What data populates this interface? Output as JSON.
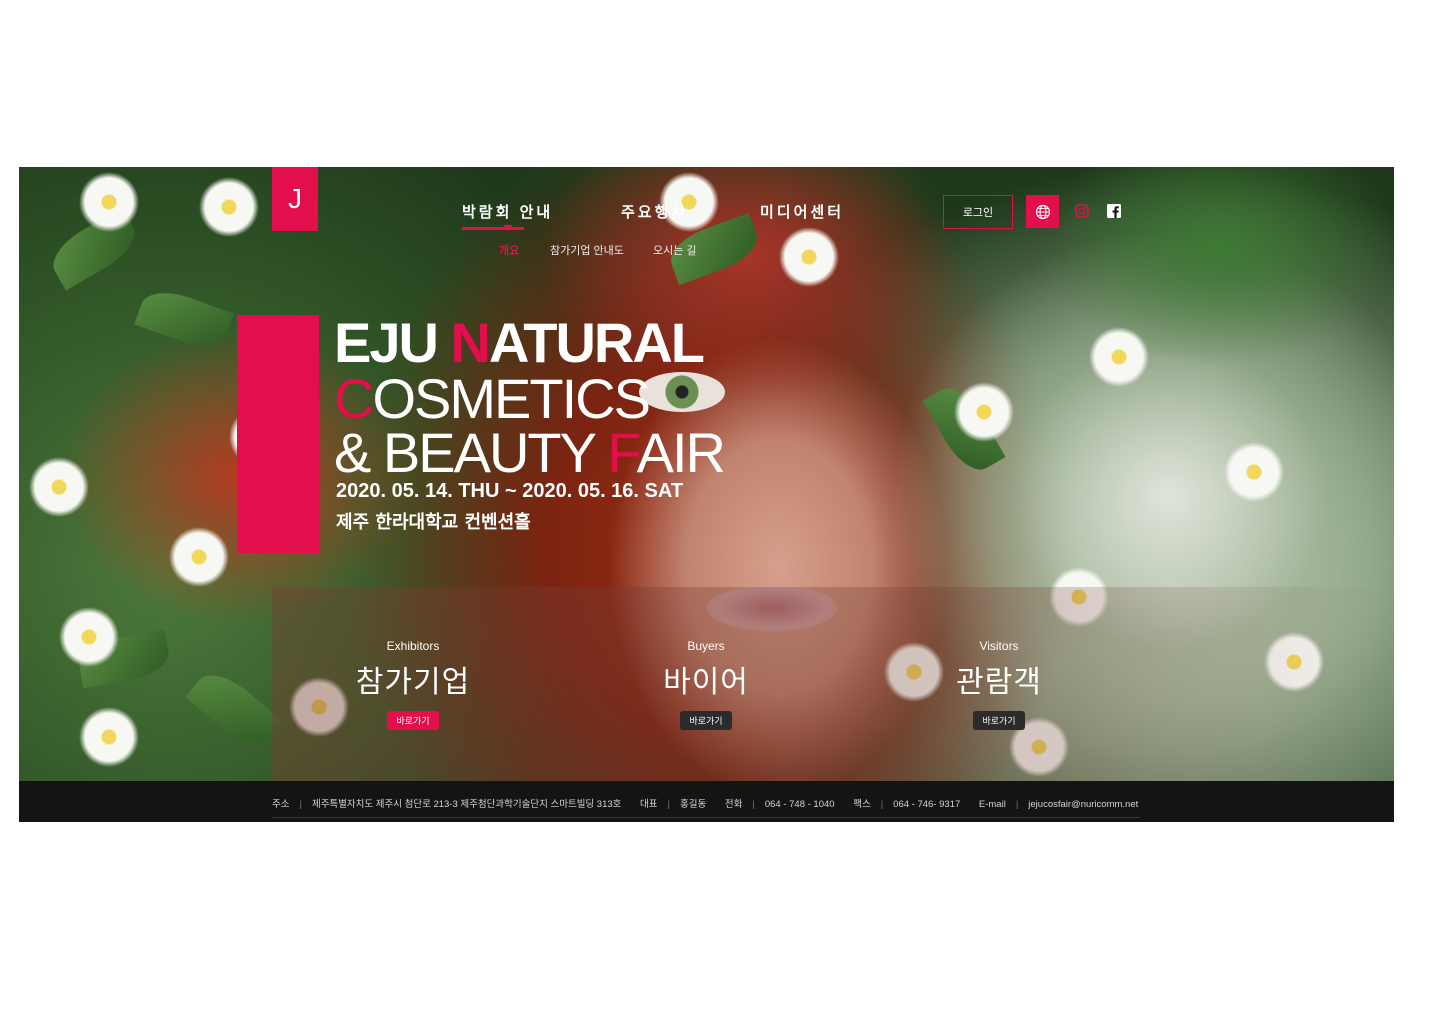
{
  "logo": {
    "letter": "J"
  },
  "nav": {
    "items": [
      {
        "label": "박람회 안내"
      },
      {
        "label": "주요행사"
      },
      {
        "label": "미디어센터"
      }
    ],
    "sub_items": [
      {
        "label": "개요"
      },
      {
        "label": "참가기업 안내도"
      },
      {
        "label": "오시는 길"
      }
    ]
  },
  "header": {
    "login_label": "로그인",
    "icons": [
      "globe-icon",
      "instagram-icon",
      "facebook-icon"
    ]
  },
  "hero": {
    "title_line1_a": "EJU ",
    "title_line1_b": "N",
    "title_line1_c": "ATURAL",
    "title_line2_a": "C",
    "title_line2_b": "OSMETICS",
    "title_line3_a": "& BEAUTY ",
    "title_line3_b": "F",
    "title_line3_c": "AIR",
    "date": "2020. 05. 14. THU ~ 2020. 05. 16. SAT",
    "venue": "제주 한라대학교 컨벤션홀"
  },
  "cta": [
    {
      "en": "Exhibitors",
      "ko": "참가기업",
      "button": "바로가기"
    },
    {
      "en": "Buyers",
      "ko": "바이어",
      "button": "바로가기"
    },
    {
      "en": "Visitors",
      "ko": "관람객",
      "button": "바로가기"
    }
  ],
  "footer": {
    "address_label": "주소",
    "address": "제주특별자치도 제주시 첨단로 213-3 제주첨단과학기술단지 스마트빌딩 313호",
    "ceo_label": "대표",
    "ceo": "홍길동",
    "phone_label": "전화",
    "phone": "064 - 748 - 1040",
    "fax_label": "팩스",
    "fax": "064 - 746- 9317",
    "email_label": "E-mail",
    "email": "jejucosfair@nuricomm.net"
  },
  "colors": {
    "accent": "#e30e4c",
    "footer_bg": "#141414"
  }
}
